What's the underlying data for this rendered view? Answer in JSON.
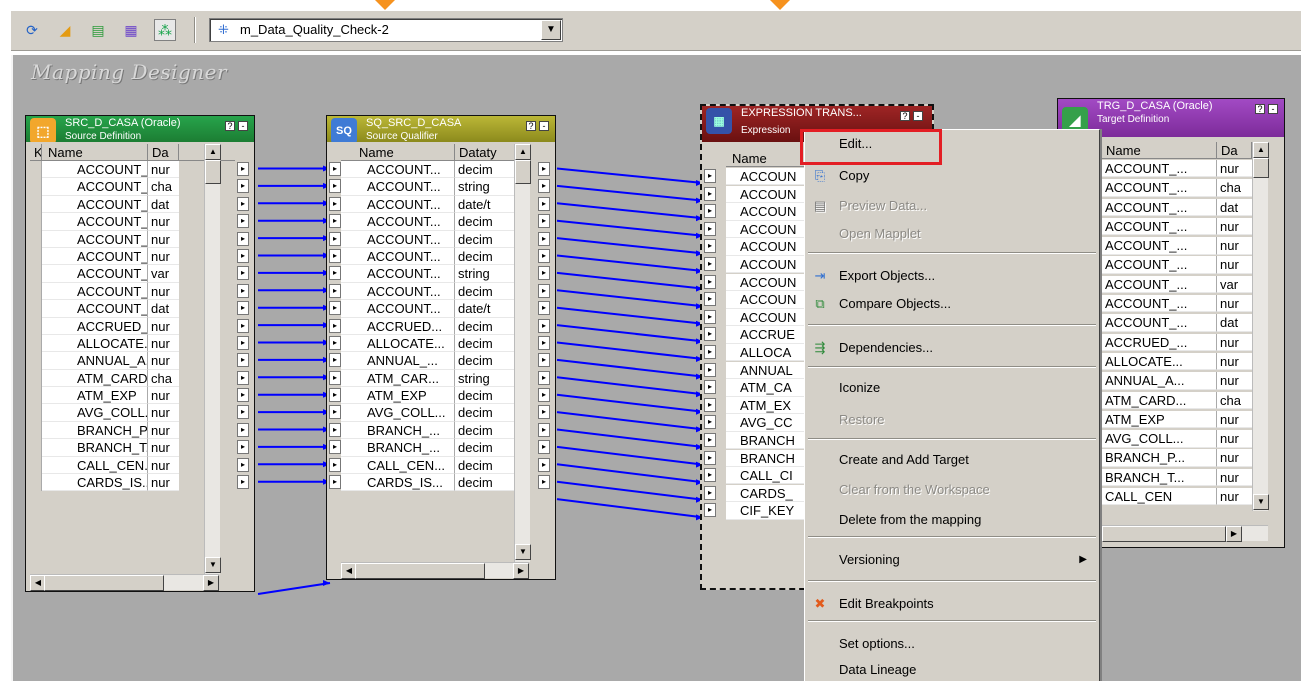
{
  "toolbar": {
    "icons": [
      "source-analyzer-icon",
      "target-designer-icon",
      "transformation-developer-icon",
      "mapplet-designer-icon",
      "mapping-designer-icon"
    ],
    "mapping_name": "m_Data_Quality_Check-2"
  },
  "workspace": {
    "title": "Mapping Designer"
  },
  "source": {
    "title": "SRC_D_CASA (Oracle)",
    "subtitle": "Source Definition",
    "col_key": "K",
    "col_name": "Name",
    "col_type": "Da",
    "rows": [
      {
        "name": "ACCOUNT_...",
        "type": "nur"
      },
      {
        "name": "ACCOUNT_...",
        "type": "cha"
      },
      {
        "name": "ACCOUNT_...",
        "type": "dat"
      },
      {
        "name": "ACCOUNT_...",
        "type": "nur"
      },
      {
        "name": "ACCOUNT_...",
        "type": "nur"
      },
      {
        "name": "ACCOUNT_...",
        "type": "nur"
      },
      {
        "name": "ACCOUNT_...",
        "type": "var"
      },
      {
        "name": "ACCOUNT_...",
        "type": "nur"
      },
      {
        "name": "ACCOUNT_...",
        "type": "dat"
      },
      {
        "name": "ACCRUED_...",
        "type": "nur"
      },
      {
        "name": "ALLOCATE...",
        "type": "nur"
      },
      {
        "name": "ANNUAL_A...",
        "type": "nur"
      },
      {
        "name": "ATM_CARD...",
        "type": "cha"
      },
      {
        "name": "ATM_EXP",
        "type": "nur"
      },
      {
        "name": "AVG_COLL...",
        "type": "nur"
      },
      {
        "name": "BRANCH_P...",
        "type": "nur"
      },
      {
        "name": "BRANCH_T...",
        "type": "nur"
      },
      {
        "name": "CALL_CEN...",
        "type": "nur"
      },
      {
        "name": "CARDS_IS...",
        "type": "nur"
      }
    ]
  },
  "qualifier": {
    "title": "SQ_SRC_D_CASA",
    "subtitle": "Source Qualifier",
    "col_name": "Name",
    "col_type": "Dataty",
    "rows": [
      {
        "name": "ACCOUNT...",
        "type": "decim"
      },
      {
        "name": "ACCOUNT...",
        "type": "string"
      },
      {
        "name": "ACCOUNT...",
        "type": "date/t"
      },
      {
        "name": "ACCOUNT...",
        "type": "decim"
      },
      {
        "name": "ACCOUNT...",
        "type": "decim"
      },
      {
        "name": "ACCOUNT...",
        "type": "decim"
      },
      {
        "name": "ACCOUNT...",
        "type": "string"
      },
      {
        "name": "ACCOUNT...",
        "type": "decim"
      },
      {
        "name": "ACCOUNT...",
        "type": "date/t"
      },
      {
        "name": "ACCRUED...",
        "type": "decim"
      },
      {
        "name": "ALLOCATE...",
        "type": "decim"
      },
      {
        "name": "ANNUAL_...",
        "type": "decim"
      },
      {
        "name": "ATM_CAR...",
        "type": "string"
      },
      {
        "name": "ATM_EXP",
        "type": "decim"
      },
      {
        "name": "AVG_COLL...",
        "type": "decim"
      },
      {
        "name": "BRANCH_...",
        "type": "decim"
      },
      {
        "name": "BRANCH_...",
        "type": "decim"
      },
      {
        "name": "CALL_CEN...",
        "type": "decim"
      },
      {
        "name": "CARDS_IS...",
        "type": "decim"
      }
    ]
  },
  "expression": {
    "title": "EXPRESSION TRANS...",
    "subtitle": "Expression",
    "col_name": "Name",
    "rows": [
      "ACCOUN",
      "ACCOUN",
      "ACCOUN",
      "ACCOUN",
      "ACCOUN",
      "ACCOUN",
      "ACCOUN",
      "ACCOUN",
      "ACCOUN",
      "ACCRUE",
      "ALLOCA",
      "ANNUAL",
      "ATM_CA",
      "ATM_EX",
      "AVG_CC",
      "BRANCH",
      "BRANCH",
      "CALL_CI",
      "CARDS_",
      "CIF_KEY"
    ]
  },
  "target": {
    "title": "TRG_D_CASA (Oracle)",
    "subtitle": "Target Definition",
    "col_name": "Name",
    "col_type": "Da",
    "rows": [
      {
        "name": "ACCOUNT_...",
        "type": "nur"
      },
      {
        "name": "ACCOUNT_...",
        "type": "cha"
      },
      {
        "name": "ACCOUNT_...",
        "type": "dat"
      },
      {
        "name": "ACCOUNT_...",
        "type": "nur"
      },
      {
        "name": "ACCOUNT_...",
        "type": "nur"
      },
      {
        "name": "ACCOUNT_...",
        "type": "nur"
      },
      {
        "name": "ACCOUNT_...",
        "type": "var"
      },
      {
        "name": "ACCOUNT_...",
        "type": "nur"
      },
      {
        "name": "ACCOUNT_...",
        "type": "dat"
      },
      {
        "name": "ACCRUED_...",
        "type": "nur"
      },
      {
        "name": "ALLOCATE...",
        "type": "nur"
      },
      {
        "name": "ANNUAL_A...",
        "type": "nur"
      },
      {
        "name": "ATM_CARD...",
        "type": "cha"
      },
      {
        "name": "ATM_EXP",
        "type": "nur"
      },
      {
        "name": "AVG_COLL...",
        "type": "nur"
      },
      {
        "name": "BRANCH_P...",
        "type": "nur"
      },
      {
        "name": "BRANCH_T...",
        "type": "nur"
      },
      {
        "name": "CALL_CEN",
        "type": "nur"
      }
    ]
  },
  "context_menu": {
    "items": [
      {
        "label": "Edit...",
        "icon": "",
        "disabled": false
      },
      {
        "label": "Copy",
        "icon": "copy-icon",
        "disabled": false
      },
      {
        "label": "Preview Data...",
        "icon": "preview-data-icon",
        "disabled": true
      },
      {
        "label": "Open Mapplet",
        "icon": "",
        "disabled": true
      },
      {
        "label": "Export Objects...",
        "icon": "export-icon",
        "disabled": false
      },
      {
        "label": "Compare Objects...",
        "icon": "compare-icon",
        "disabled": false
      },
      {
        "label": "Dependencies...",
        "icon": "dependencies-icon",
        "disabled": false
      },
      {
        "label": "Iconize",
        "icon": "",
        "disabled": false
      },
      {
        "label": "Restore",
        "icon": "",
        "disabled": true
      },
      {
        "label": "Create and Add Target",
        "icon": "",
        "disabled": false
      },
      {
        "label": "Clear from the Workspace",
        "icon": "",
        "disabled": true
      },
      {
        "label": "Delete from the mapping",
        "icon": "",
        "disabled": false
      },
      {
        "label": "Versioning",
        "icon": "",
        "disabled": false,
        "submenu": true
      },
      {
        "label": "Edit Breakpoints",
        "icon": "breakpoint-icon",
        "disabled": false
      },
      {
        "label": "Set options...",
        "icon": "",
        "disabled": false
      },
      {
        "label": "Data Lineage",
        "icon": "",
        "disabled": false
      }
    ]
  },
  "colors": {
    "source_header": "#1f8d3a",
    "qualifier_header": "#a6a326",
    "expression_header": "#8b1c1c",
    "target_header": "#8d2fb0",
    "link_line": "#0000ff",
    "highlight_box": "#e31e24"
  }
}
